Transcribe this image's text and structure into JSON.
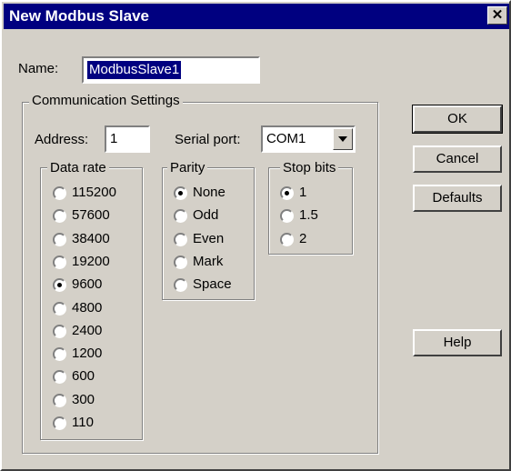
{
  "window": {
    "title": "New Modbus Slave",
    "close_glyph": "✕"
  },
  "name": {
    "label": "Name:",
    "value": "ModbusSlave1"
  },
  "comm": {
    "title": "Communication Settings",
    "address_label": "Address:",
    "address_value": "1",
    "serial_label": "Serial port:",
    "serial_value": "COM1"
  },
  "data_rate": {
    "title": "Data rate",
    "options": [
      "115200",
      "57600",
      "38400",
      "19200",
      "9600",
      "4800",
      "2400",
      "1200",
      "600",
      "300",
      "110"
    ],
    "selected": "9600"
  },
  "parity": {
    "title": "Parity",
    "options": [
      "None",
      "Odd",
      "Even",
      "Mark",
      "Space"
    ],
    "selected": "None"
  },
  "stop_bits": {
    "title": "Stop bits",
    "options": [
      "1",
      "1.5",
      "2"
    ],
    "selected": "1"
  },
  "buttons": {
    "ok": "OK",
    "cancel": "Cancel",
    "defaults": "Defaults",
    "help": "Help"
  },
  "colors": {
    "title_bar": "#000080",
    "face": "#d4d0c8"
  }
}
